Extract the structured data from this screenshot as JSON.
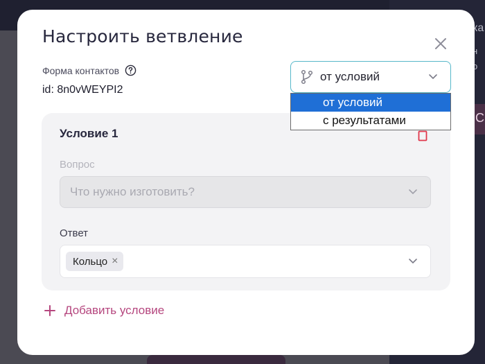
{
  "backdrop": {
    "right_text_1": "ка",
    "right_text_2": "н",
    "right_text_3": "о",
    "right_button": "С"
  },
  "modal": {
    "title": "Настроить ветвление",
    "form_label": "Форма контактов",
    "form_id_prefix": "id:",
    "form_id_value": "8n0vWEYPI2",
    "branch_select": {
      "value": "от условий",
      "options": [
        "от условий",
        "с результатами"
      ],
      "selected_index": 0
    },
    "condition": {
      "title": "Условие 1",
      "question_label": "Вопрос",
      "question_placeholder": "Что нужно изготовить?",
      "answer_label": "Ответ",
      "answer_chips": [
        "Кольцо"
      ]
    },
    "add_condition_label": "Добавить условие"
  },
  "colors": {
    "accent": "#b5467e",
    "select_border": "#56b7c9",
    "option_selected": "#1f6fd6",
    "delete_icon": "#e0364b"
  },
  "icons": {
    "close": "close-icon",
    "help": "help-icon",
    "branch": "branch-icon",
    "chevron": "chevron-down-icon",
    "trash": "trash-icon",
    "plus": "plus-icon"
  }
}
